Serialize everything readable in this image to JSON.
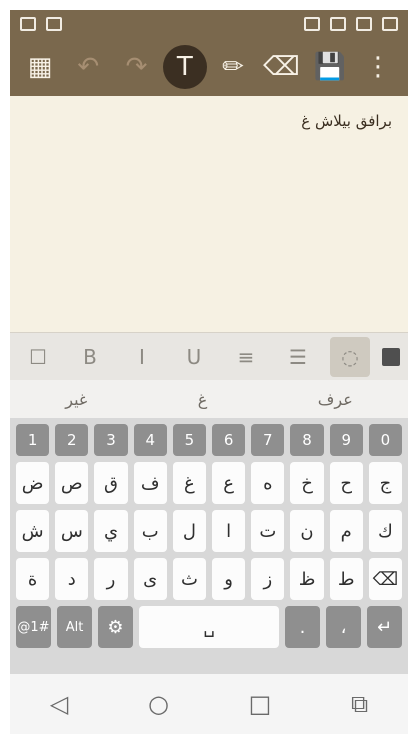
{
  "status": {
    "left_icons": [
      "gallery-icon",
      "gamepad-icon"
    ],
    "right_icons": [
      "nfc-icon",
      "rotate-icon",
      "battery-icon",
      "signal-icon"
    ]
  },
  "toolbar": {
    "items": [
      {
        "name": "grid-icon",
        "glyph": "▦",
        "dim": false
      },
      {
        "name": "undo-icon",
        "glyph": "↶",
        "dim": true
      },
      {
        "name": "redo-icon",
        "glyph": "↷",
        "dim": true
      },
      {
        "name": "text-icon",
        "glyph": "T",
        "active": true
      },
      {
        "name": "pen-icon",
        "glyph": "✏",
        "dim": false
      },
      {
        "name": "eraser-icon",
        "glyph": "⌫",
        "dim": false
      },
      {
        "name": "save-icon",
        "glyph": "💾",
        "dim": false
      },
      {
        "name": "more-icon",
        "glyph": "⋮",
        "dim": false
      }
    ]
  },
  "editor": {
    "text": "برافق بيلاش غ"
  },
  "format": {
    "items": [
      {
        "name": "checkbox-icon",
        "glyph": "☐"
      },
      {
        "name": "bold-icon",
        "glyph": "B"
      },
      {
        "name": "italic-icon",
        "glyph": "I"
      },
      {
        "name": "underline-icon",
        "glyph": "U"
      },
      {
        "name": "align-icon",
        "glyph": "≡"
      },
      {
        "name": "center-icon",
        "glyph": "☰"
      },
      {
        "name": "color-selected-icon",
        "glyph": "◌",
        "sel": true
      },
      {
        "name": "color-swatch",
        "glyph": "",
        "swatch": true
      }
    ]
  },
  "suggestions": [
    "عرف",
    "غ",
    "غير"
  ],
  "keyboard": {
    "numbers": [
      "1",
      "2",
      "3",
      "4",
      "5",
      "6",
      "7",
      "8",
      "9",
      "0"
    ],
    "rows": [
      [
        "ض",
        "ص",
        "ق",
        "ف",
        "غ",
        "ع",
        "ه",
        "خ",
        "ح",
        "ج"
      ],
      [
        "ش",
        "س",
        "ي",
        "ب",
        "ل",
        "ا",
        "ت",
        "ن",
        "م",
        "ك"
      ],
      [
        "ة",
        "د",
        "ر",
        "ى",
        "ث",
        "و",
        "ز",
        "ظ",
        "ط",
        "⌫"
      ]
    ],
    "bottom": [
      "@1#",
      "Alt",
      "⚙",
      "␣",
      ".",
      "،",
      "↵"
    ]
  },
  "nav": [
    "◁",
    "○",
    "□",
    "⧉"
  ]
}
